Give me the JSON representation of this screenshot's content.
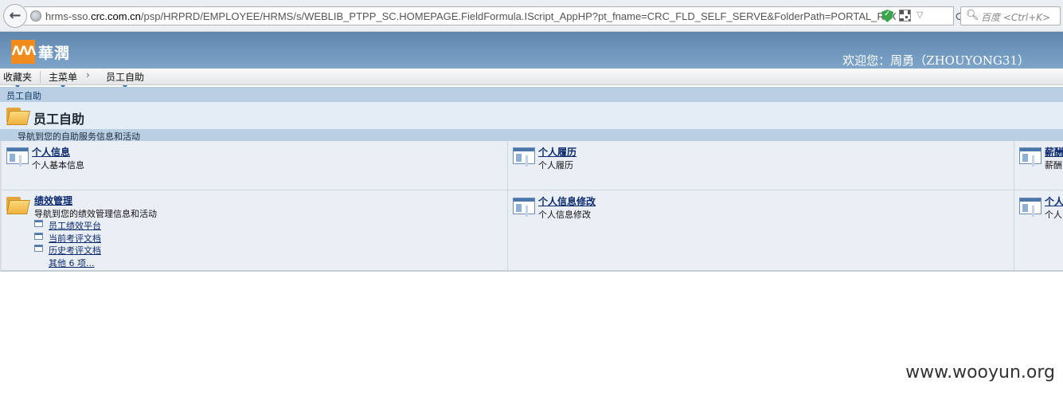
{
  "browser": {
    "url_prefix": "hrms-sso.",
    "url_host": "crc.com.cn",
    "url_path": "/psp/HRPRD/EMPLOYEE/HRMS/s/WEBLIB_PTPP_SC.HOMEPAGE.FieldFormula.IScript_AppHP?pt_fname=CRC_FLD_SELF_SERVE&FolderPath=PORTAL_ROOT_OBJE(",
    "search_placeholder": "百度 <Ctrl+K>"
  },
  "header": {
    "logo_text": "華潤",
    "welcome": "欢迎您：周勇（ZHOUYONG31）"
  },
  "menubar": {
    "favorites": "收藏夹",
    "main_menu": "主菜单",
    "employee_self_service": "员工自助"
  },
  "page": {
    "breadcrumb": "员工自助",
    "title": "员工自助",
    "description": "导航到您的自助服务信息和活动"
  },
  "cells": {
    "personal_info": {
      "title": "个人信息",
      "desc": "个人基本信息"
    },
    "resume": {
      "title": "个人履历",
      "desc": "个人履历"
    },
    "salary": {
      "title": "薪酬",
      "desc": "薪酬"
    },
    "performance": {
      "title": "绩效管理",
      "desc": "导航到您的绩效管理信息和活动",
      "links": [
        "员工绩效平台",
        "当前考评文档",
        "历史考评文档"
      ],
      "more": "其他 6 项..."
    },
    "personal_info_edit": {
      "title": "个人信息修改",
      "desc": "个人信息修改"
    },
    "personal_more": {
      "title": "个人",
      "desc": "个人"
    }
  },
  "watermark": "www.wooyun.org"
}
